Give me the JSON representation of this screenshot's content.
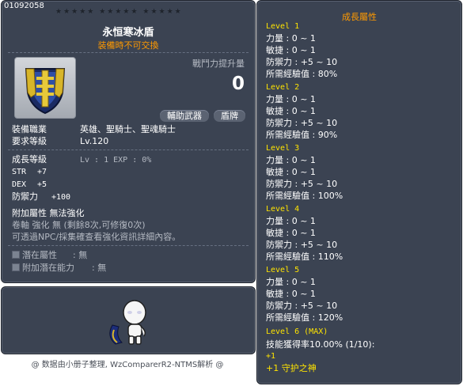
{
  "item": {
    "id": "01092058",
    "name": "永恒寒冰盾",
    "trade_note": "装備時不可交換",
    "power_label": "戰鬥力提升量",
    "power_value": "0",
    "tags": [
      "輔助武器",
      "盾牌"
    ],
    "job_label": "裝備職業",
    "job_value": "英雄、聖騎士、聖魂騎士",
    "req_label": "要求等級",
    "req_value": "Lv.120",
    "growth_label": "成長等級",
    "growth_value": "Lv : 1  EXP : 0%",
    "stats": [
      {
        "label": "STR",
        "value": "+7"
      },
      {
        "label": "DEX",
        "value": "+5"
      },
      {
        "label": "防禦力",
        "value": "+100"
      }
    ],
    "extra_attr": "附加屬性 無法強化",
    "scroll_info": "卷軸 強化 無 (剩餘8次,可修復0次)",
    "npc_note": "可透過NPC/採集確查看強化資訊詳細內容。",
    "potential_label": "潛在屬性",
    "potential_value": ": 無",
    "add_potential_label": "附加潛在能力",
    "add_potential_value": ": 無"
  },
  "footer": "@ 数据由小册子整理, WzComparerR2-NTMS解析 @",
  "growth": {
    "title": "成長屬性",
    "levels": [
      {
        "title": "Level 1",
        "lines": [
          "力量 : 0 ~ 1",
          "敏捷 : 0 ~ 1",
          "防禦力 : +5 ~ 10",
          "所需經驗值 : 80%"
        ]
      },
      {
        "title": "Level 2",
        "lines": [
          "力量 : 0 ~ 1",
          "敏捷 : 0 ~ 1",
          "防禦力 : +5 ~ 10",
          "所需經驗值 : 90%"
        ]
      },
      {
        "title": "Level 3",
        "lines": [
          "力量 : 0 ~ 1",
          "敏捷 : 0 ~ 1",
          "防禦力 : +5 ~ 10",
          "所需經驗值 : 100%"
        ]
      },
      {
        "title": "Level 4",
        "lines": [
          "力量 : 0 ~ 1",
          "敏捷 : 0 ~ 1",
          "防禦力 : +5 ~ 10",
          "所需經驗值 : 110%"
        ]
      },
      {
        "title": "Level 5",
        "lines": [
          "力量 : 0 ~ 1",
          "敏捷 : 0 ~ 1",
          "防禦力 : +5 ~ 10",
          "所需經驗值 : 120%"
        ]
      }
    ],
    "max_level": {
      "title": "Level 6 (MAX)",
      "skill": "技能獲得率10.00% (1/10):",
      "plus": "+1",
      "bonus": "+1 守护之神"
    }
  },
  "colors": {
    "panel": "#3b4352",
    "accent_orange": "#ff9a00",
    "level_yellow": "#ffe400",
    "max_green": "#c7e000"
  }
}
